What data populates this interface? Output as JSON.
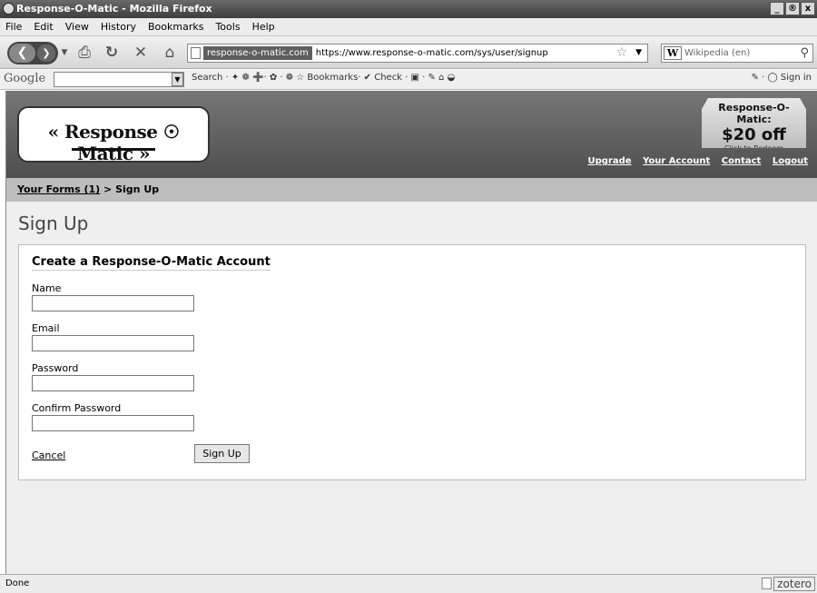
{
  "window": {
    "title": "Response-O-Matic - Mozilla Firefox",
    "controls": [
      "_",
      "®",
      "x"
    ]
  },
  "menu": {
    "items": [
      "File",
      "Edit",
      "View",
      "History",
      "Bookmarks",
      "Tools",
      "Help"
    ]
  },
  "navbar": {
    "site_label": "response-o-matic.com",
    "url": "https://www.response-o-matic.com/sys/user/signup",
    "search_engine": "W",
    "search_placeholder": "Wikipedia (en)"
  },
  "googlebar": {
    "logo": "Google",
    "tools": "Search · ✦ ❁ ➕·  ✿ · ❁ ☆ Bookmarks·  ✔ Check · ▣  ·  ✎  ⌂ ◒",
    "sign_in": "Sign in"
  },
  "header": {
    "logo_text": "« Response ☉ Matic »",
    "promo_title": "Response-O-Matic:",
    "promo_amount": "$20 off",
    "promo_link": "Click to Redeem",
    "links": [
      "Upgrade",
      "Your Account",
      "Contact",
      "Logout"
    ]
  },
  "breadcrumb": {
    "link": "Your Forms (1)",
    "separator": " > ",
    "current": "Sign Up"
  },
  "page": {
    "title": "Sign Up",
    "panel_title": "Create a Response-O-Matic Account",
    "fields": [
      {
        "label": "Name",
        "value": ""
      },
      {
        "label": "Email",
        "value": ""
      },
      {
        "label": "Password",
        "value": ""
      },
      {
        "label": "Confirm Password",
        "value": ""
      }
    ],
    "cancel": "Cancel",
    "submit": "Sign Up"
  },
  "status": {
    "text": "Done",
    "addon": "zotero"
  }
}
